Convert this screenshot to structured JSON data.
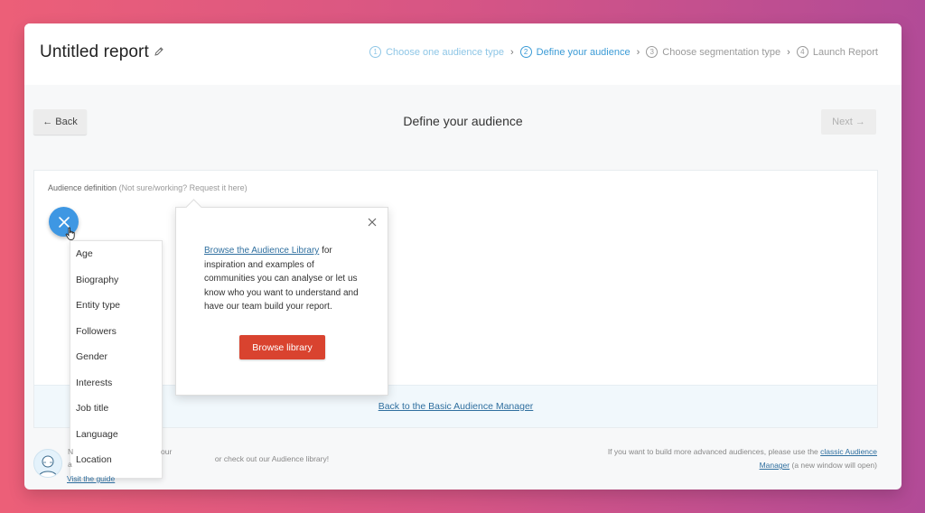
{
  "header": {
    "report_title": "Untitled report",
    "steps": [
      {
        "number": "1",
        "label": "Choose one audience type",
        "state": "done"
      },
      {
        "number": "2",
        "label": "Define your audience",
        "state": "active"
      },
      {
        "number": "3",
        "label": "Choose segmentation type",
        "state": "pending"
      },
      {
        "number": "4",
        "label": "Launch Report",
        "state": "pending"
      }
    ]
  },
  "nav": {
    "back_label": "← Back",
    "page_heading": "Define your audience",
    "next_label": "Next →"
  },
  "panel": {
    "label": "Audience definition",
    "hint": "(Not sure/working? Request it here)",
    "basic_manager_link": "Back to the Basic Audience Manager"
  },
  "criteria_menu": {
    "items": [
      "Age",
      "Biography",
      "Entity type",
      "Followers",
      "Gender",
      "Interests",
      "Job title",
      "Language",
      "Location"
    ]
  },
  "popover": {
    "link_text": "Browse the Audience Library",
    "body_text": " for inspiration and examples of communities you can analyse or let us know who you want to understand and have our team build your report.",
    "button_label": "Browse library"
  },
  "footer": {
    "left_partial_1": "N",
    "left_partial_2": "our",
    "left_partial_3": "a",
    "left_partial_4": "Visit the guide",
    "explore_text": "or check out our Audience library!",
    "advanced_prefix": "If you want to build more advanced audiences, please use the",
    "advanced_link": "classic Audience Manager",
    "advanced_suffix": "(a new window will open)"
  },
  "colors": {
    "accent_blue": "#3e97e3",
    "browse_button_red": "#d9432f",
    "link_blue": "#2f6f9f"
  },
  "icons": {
    "edit": "pencil-icon",
    "close": "close-icon",
    "add": "close-icon",
    "cursor": "hand-pointer-icon"
  }
}
